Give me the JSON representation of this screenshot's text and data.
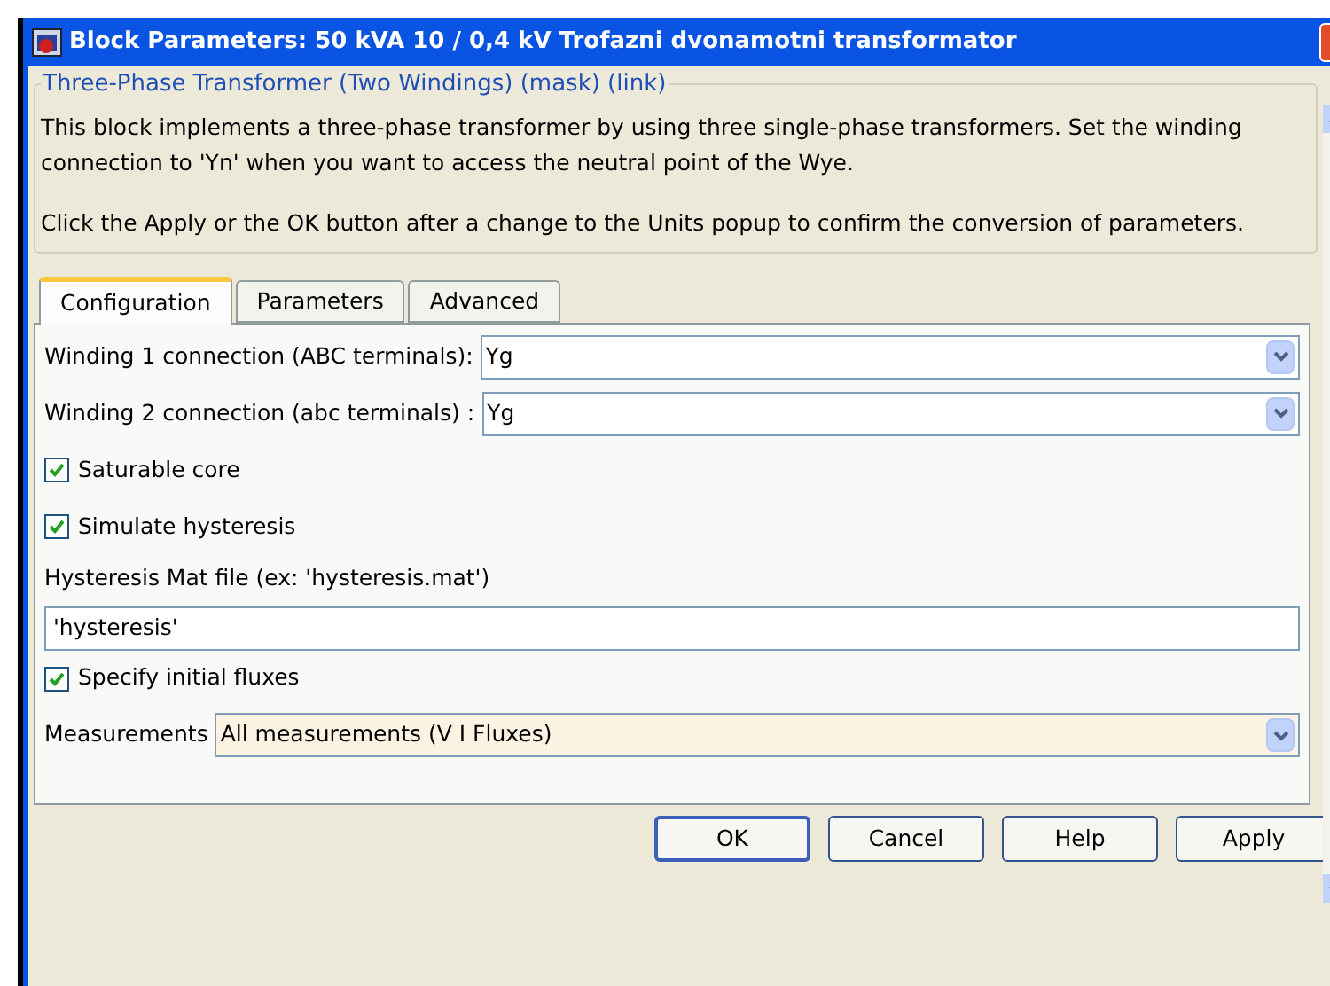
{
  "window": {
    "title": "Block Parameters: 50 kVA 10 / 0,4 kV Trofazni dvonamotni transformator"
  },
  "group": {
    "title": "Three-Phase Transformer (Two Windings) (mask) (link)",
    "paragraphs": [
      "This block implements a three-phase transformer by using three single-phase transformers. Set the winding connection to 'Yn'  when you want to access the neutral point of the Wye.",
      "Click the Apply or the OK button after a change to the Units popup to confirm the conversion of parameters."
    ]
  },
  "tabs": [
    {
      "label": "Configuration",
      "selected": true
    },
    {
      "label": "Parameters",
      "selected": false
    },
    {
      "label": "Advanced",
      "selected": false
    }
  ],
  "fields": [
    {
      "kind": "dropdown",
      "label": "Winding 1 connection (ABC terminals):",
      "value": "Yg",
      "highlighted": false
    },
    {
      "kind": "dropdown",
      "label": "Winding 2 connection (abc terminals) :",
      "value": "Yg",
      "highlighted": false
    },
    {
      "kind": "checkbox",
      "label": "Saturable core",
      "checked": true
    },
    {
      "kind": "checkbox",
      "label": "Simulate hysteresis",
      "checked": true
    },
    {
      "kind": "text",
      "label": "Hysteresis Mat file (ex: 'hysteresis.mat')",
      "value": "'hysteresis'"
    },
    {
      "kind": "checkbox",
      "label": "Specify initial fluxes",
      "checked": true
    },
    {
      "kind": "dropdown",
      "label": "Measurements",
      "value": "All measurements (V I Fluxes)",
      "highlighted": true
    }
  ],
  "buttons": [
    {
      "label": "OK",
      "default": true
    },
    {
      "label": "Cancel",
      "default": false
    },
    {
      "label": "Help",
      "default": false
    },
    {
      "label": "Apply",
      "default": false
    }
  ]
}
